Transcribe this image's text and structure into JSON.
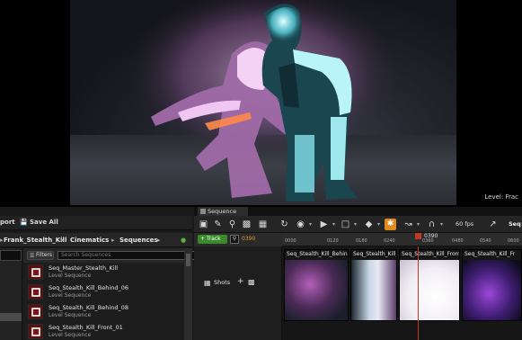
{
  "viewport": {
    "label": "Level: Frac"
  },
  "content_browser": {
    "toolbar": {
      "import_label": "port",
      "save_all_label": "Save All"
    },
    "path": [
      "Frank_Stealth_Kill",
      "Cinematics",
      "Sequences"
    ],
    "filters_label": "Filters",
    "search_placeholder": "Search Sequences",
    "assets": [
      {
        "name": "Seq_Master_Stealth_Kill",
        "type": "Level Sequence"
      },
      {
        "name": "Seq_Stealth_Kill_Behind_06",
        "type": "Level Sequence"
      },
      {
        "name": "Seq_Stealth_Kill_Behind_08",
        "type": "Level Sequence"
      },
      {
        "name": "Seq_Stealth_Kill_Front_01",
        "type": "Level Sequence"
      }
    ]
  },
  "sequencer": {
    "tab_label": "Sequence",
    "track_button": "+ Track",
    "frame_readout": "0390",
    "fps_label": "60 fps",
    "sequence_name": "Seq",
    "shots_label": "Shots",
    "playhead_label": "0390",
    "ruler_ticks": [
      "0000",
      "0120",
      "0180",
      "0240",
      "0360",
      "0480",
      "0540",
      "0600"
    ],
    "shots": [
      {
        "label": "Seq_Stealth_Kill_Behind"
      },
      {
        "label": "Seq_Stealth_Kill_"
      },
      {
        "label": "Seq_Stealth_Kill_Front"
      },
      {
        "label": "Seq_Stealth_Kill_Fr"
      }
    ]
  },
  "icons": [
    "save-icon",
    "browse-icon",
    "search-icon",
    "camera-icon",
    "film-icon",
    "loop-icon",
    "eye-icon",
    "play-icon",
    "key-icon",
    "snap-icon",
    "curve-icon",
    "magnet-icon"
  ],
  "colors": {
    "accent_orange": "#e08a1e",
    "track_green": "#3b8a2a",
    "playhead_red": "#c0392b",
    "asset_thumb": "#5a1010"
  }
}
